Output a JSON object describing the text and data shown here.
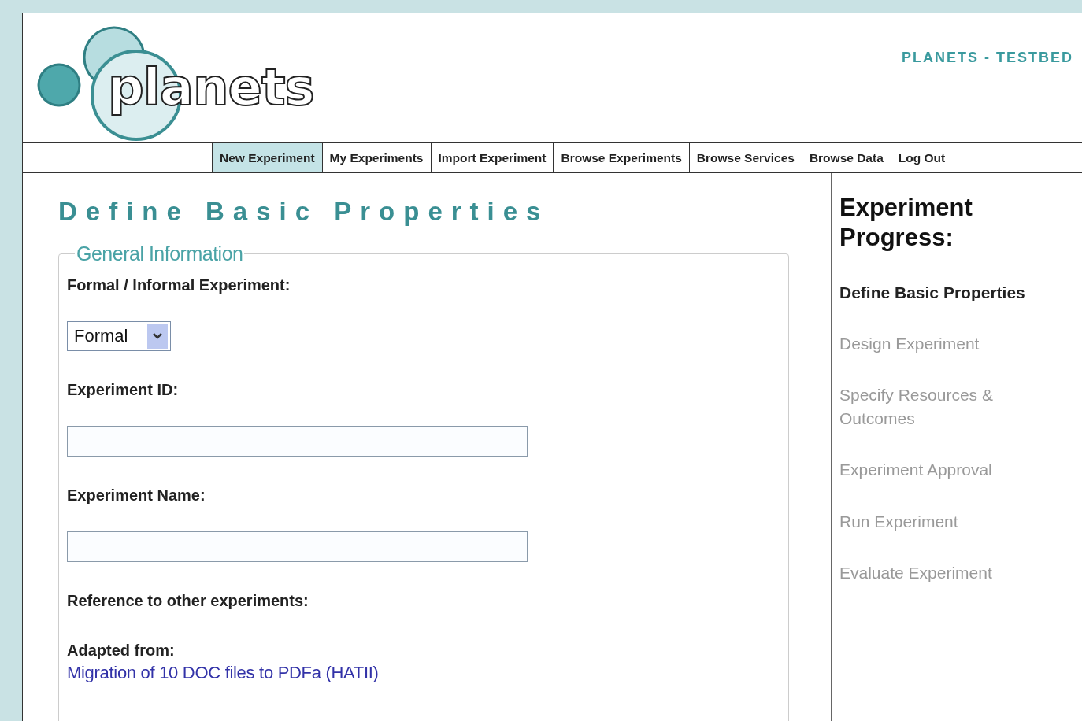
{
  "header": {
    "logo_text": "planets",
    "site_title": "PLANETS - TESTBED"
  },
  "tabs": [
    {
      "label": "New Experiment",
      "selected": true
    },
    {
      "label": "My Experiments",
      "selected": false
    },
    {
      "label": "Import Experiment",
      "selected": false
    },
    {
      "label": "Browse Experiments",
      "selected": false
    },
    {
      "label": "Browse Services",
      "selected": false
    },
    {
      "label": "Browse Data",
      "selected": false
    },
    {
      "label": "Log Out",
      "selected": false
    }
  ],
  "page_title": "Define Basic Properties",
  "fieldset": {
    "legend": "General Information",
    "fields": [
      {
        "kind": "select",
        "label": "Formal / Informal Experiment:",
        "value": "Formal"
      },
      {
        "kind": "text",
        "label": "Experiment ID:"
      },
      {
        "kind": "text",
        "label": "Experiment Name:"
      },
      {
        "kind": "heading",
        "label": "Reference to other experiments:"
      },
      {
        "kind": "link",
        "label": "Adapted from:",
        "link": "Migration of 10 DOC files to PDFa (HATII)"
      }
    ]
  },
  "progress": {
    "title": "Experiment Progress:",
    "steps": [
      {
        "label": "Define Basic Properties",
        "selected": true
      },
      {
        "label": "Design Experiment",
        "selected": false
      },
      {
        "label": "Specify Resources & Outcomes",
        "selected": false
      },
      {
        "label": "Experiment Approval",
        "selected": false
      },
      {
        "label": "Run Experiment",
        "selected": false
      },
      {
        "label": "Evaluate Experiment",
        "selected": false
      }
    ]
  }
}
